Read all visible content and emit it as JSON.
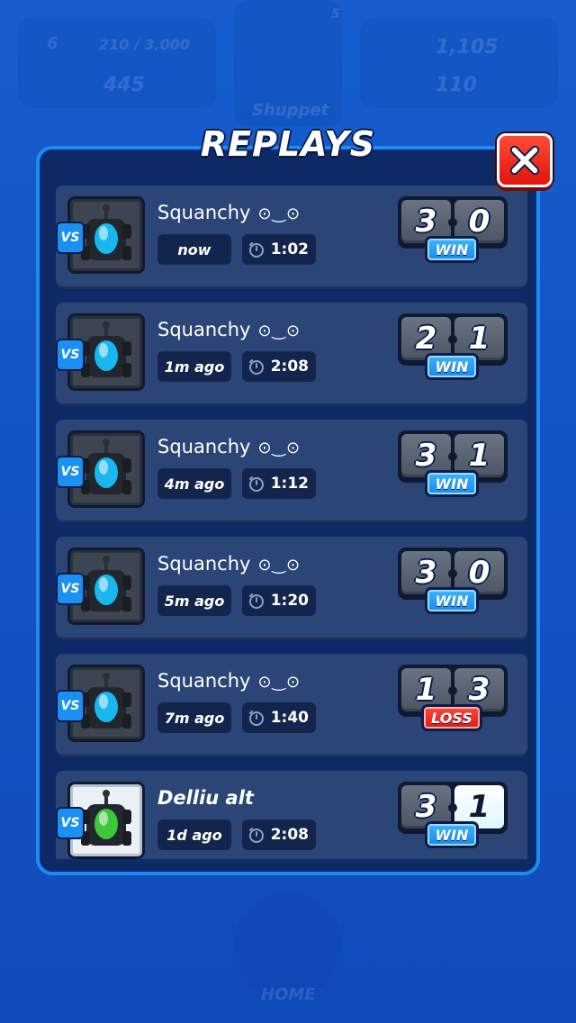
{
  "background": {
    "level": "6",
    "xp": "210 / 3,000",
    "gems": "445",
    "trophies": "1,105",
    "coins": "110",
    "brawler_rank": "5",
    "brawler_name": "Shuppet",
    "home_label": "HOME"
  },
  "panel": {
    "title": "REPLAYS",
    "close_icon": "close-x-icon"
  },
  "replays": [
    {
      "opponent": "Squanchy",
      "face": "⊙‿⊙",
      "when": "now",
      "duration": "1:02",
      "score_left": "3",
      "score_right": "0",
      "result": "WIN",
      "kart_color": "#19b6f0"
    },
    {
      "opponent": "Squanchy",
      "face": "⊙‿⊙",
      "when": "1m ago",
      "duration": "2:08",
      "score_left": "2",
      "score_right": "1",
      "result": "WIN",
      "kart_color": "#19b6f0"
    },
    {
      "opponent": "Squanchy",
      "face": "⊙‿⊙",
      "when": "4m ago",
      "duration": "1:12",
      "score_left": "3",
      "score_right": "1",
      "result": "WIN",
      "kart_color": "#19b6f0"
    },
    {
      "opponent": "Squanchy",
      "face": "⊙‿⊙",
      "when": "5m ago",
      "duration": "1:20",
      "score_left": "3",
      "score_right": "0",
      "result": "WIN",
      "kart_color": "#19b6f0"
    },
    {
      "opponent": "Squanchy",
      "face": "⊙‿⊙",
      "when": "7m ago",
      "duration": "1:40",
      "score_left": "1",
      "score_right": "3",
      "result": "LOSS",
      "kart_color": "#19b6f0"
    },
    {
      "opponent": "Delliu alt",
      "face": "",
      "when": "1d ago",
      "duration": "2:08",
      "score_left": "3",
      "score_right": "1",
      "result": "WIN",
      "kart_color": "#3cc83a"
    }
  ],
  "vs_label": "VS",
  "colors": {
    "win": "#1a88ee",
    "loss": "#dd1a10",
    "panel_border": "#1d8bf0",
    "row_bg": "#2c4577"
  }
}
